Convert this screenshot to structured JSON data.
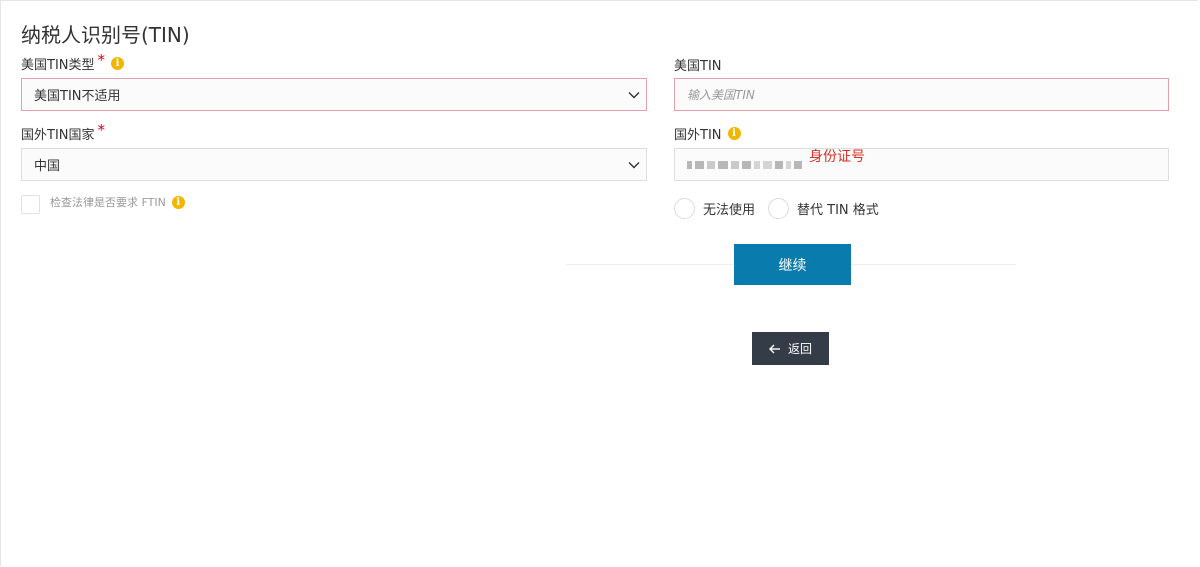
{
  "page_title": "纳税人识别号(TIN)",
  "us_tin_type": {
    "label": "美国TIN类型",
    "required_mark": "*",
    "info_icon": "info-icon",
    "selected_value": "美国TIN不适用"
  },
  "us_tin": {
    "label": "美国TIN",
    "placeholder": "输入美国TIN",
    "value": ""
  },
  "foreign_tin_country": {
    "label": "国外TIN国家",
    "required_mark": "*",
    "selected_value": "中国"
  },
  "foreign_tin": {
    "label": "国外TIN",
    "info_icon": "info-icon",
    "annotation": "身份证号"
  },
  "ftin_check": {
    "label": "检查法律是否要求 FTIN",
    "checked": false
  },
  "radio_options": [
    {
      "label": "无法使用"
    },
    {
      "label": "替代 TIN 格式"
    }
  ],
  "buttons": {
    "continue_label": "继续",
    "back_label": "返回",
    "back_icon": "arrow-left-icon"
  },
  "colors": {
    "primary_button": "#0a7bad",
    "back_button": "#343d47",
    "required": "#d9001b",
    "info": "#f2b600",
    "error_border": "#e3a0a8",
    "annotation": "#d93025"
  }
}
